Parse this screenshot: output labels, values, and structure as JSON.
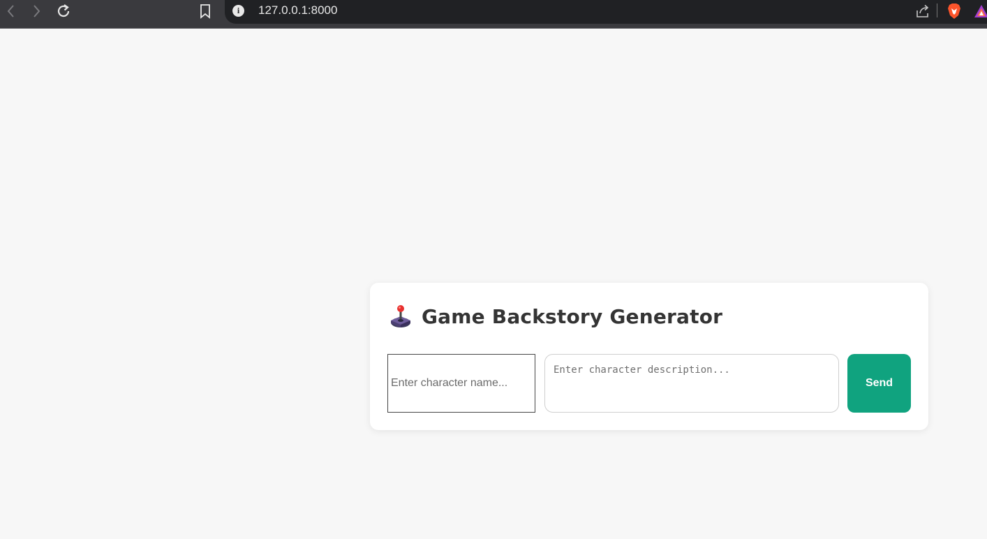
{
  "browser": {
    "url": "127.0.0.1:8000",
    "icons": [
      "back-icon",
      "forward-icon",
      "reload-icon",
      "bookmark-icon",
      "site-info-icon",
      "share-icon",
      "brave-shield-icon",
      "brave-rewards-icon"
    ]
  },
  "app": {
    "title": "Game Backstory Generator",
    "title_icon": "joystick-icon",
    "name_placeholder": "Enter character name...",
    "description_placeholder": "Enter character description...",
    "send_label": "Send"
  },
  "colors": {
    "accent": "#10a37f",
    "background": "#f7f7f7",
    "card": "#ffffff",
    "title_text": "#343434"
  }
}
